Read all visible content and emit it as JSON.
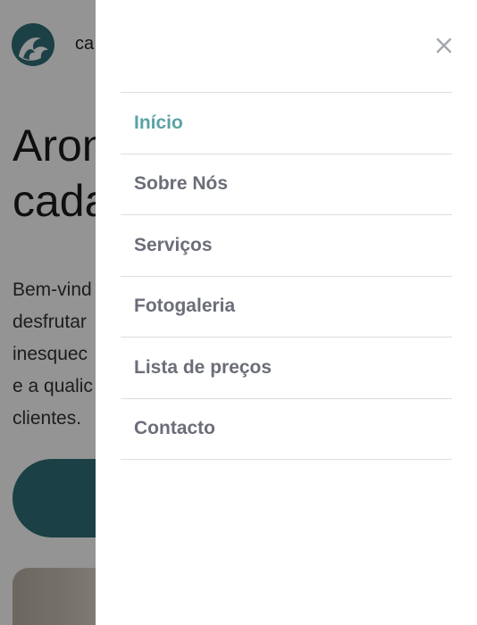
{
  "background": {
    "brand_text": "ca",
    "hero_title_lines": [
      "Aron",
      "cada"
    ],
    "hero_text_lines": [
      "Bem-vind",
      "desfrutar",
      "inesquec",
      "e a qualic",
      "clientes."
    ],
    "colors": {
      "accent": "#2f6f78",
      "overlay": "rgba(0,0,0,0.42)"
    }
  },
  "drawer": {
    "close_icon": "close-icon",
    "menu": [
      {
        "label": "Início",
        "active": true
      },
      {
        "label": "Sobre Nós",
        "active": false
      },
      {
        "label": "Serviços",
        "active": false
      },
      {
        "label": "Fotogaleria",
        "active": false
      },
      {
        "label": "Lista de preços",
        "active": false
      },
      {
        "label": "Contacto",
        "active": false
      }
    ],
    "colors": {
      "active": "#5aa2a6",
      "item": "#6b6e78",
      "divider": "#dedede"
    }
  }
}
